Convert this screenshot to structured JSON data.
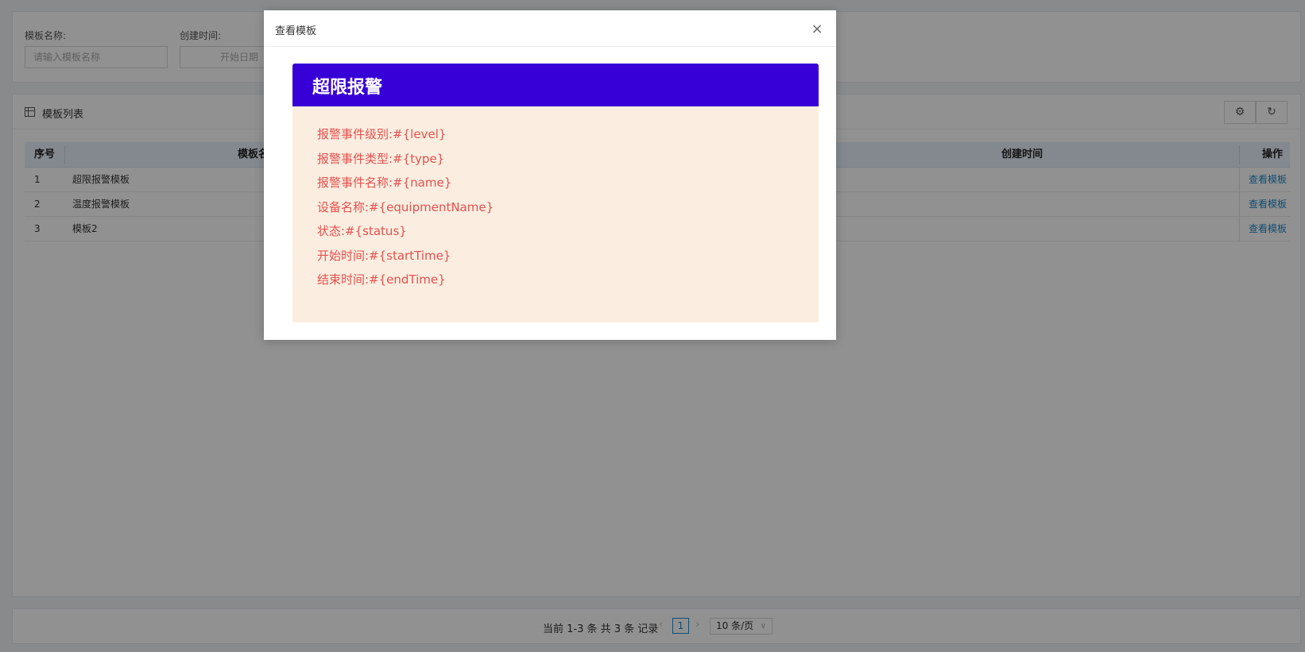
{
  "filter": {
    "name_label": "模板名称:",
    "name_placeholder": "请输入模板名称",
    "time_label": "创建时间:",
    "start_placeholder": "开始日期"
  },
  "list": {
    "title": "模板列表",
    "tools": {
      "settings_icon": "gear-icon",
      "refresh_icon": "refresh-icon"
    },
    "columns": {
      "index": "序号",
      "name": "模板名称",
      "created": "创建时间",
      "action": "操作"
    },
    "rows": [
      {
        "index": "1",
        "name": "超限报警模板",
        "action": "查看模板"
      },
      {
        "index": "2",
        "name": "温度报警模板",
        "action": "查看模板"
      },
      {
        "index": "3",
        "name": "模板2",
        "action": "查看模板"
      }
    ]
  },
  "pager": {
    "info": "当前 1-3 条 共 3 条 记录",
    "prev": "‹",
    "next": "›",
    "current_page": "1",
    "page_size": "10 条/页",
    "chevron": "∨"
  },
  "dialog": {
    "title": "查看模板",
    "close": "×",
    "template": {
      "header": "超限报警",
      "header_color": "#3700d6",
      "text_color": "#e5504f",
      "background": "#fbeee0",
      "lines": [
        "报警事件级别:#{level}",
        "报警事件类型:#{type}",
        "报警事件名称:#{name}",
        "设备名称:#{equipmentName}",
        "状态:#{status}",
        "开始时间:#{startTime}",
        "结束时间:#{endTime}"
      ]
    }
  }
}
